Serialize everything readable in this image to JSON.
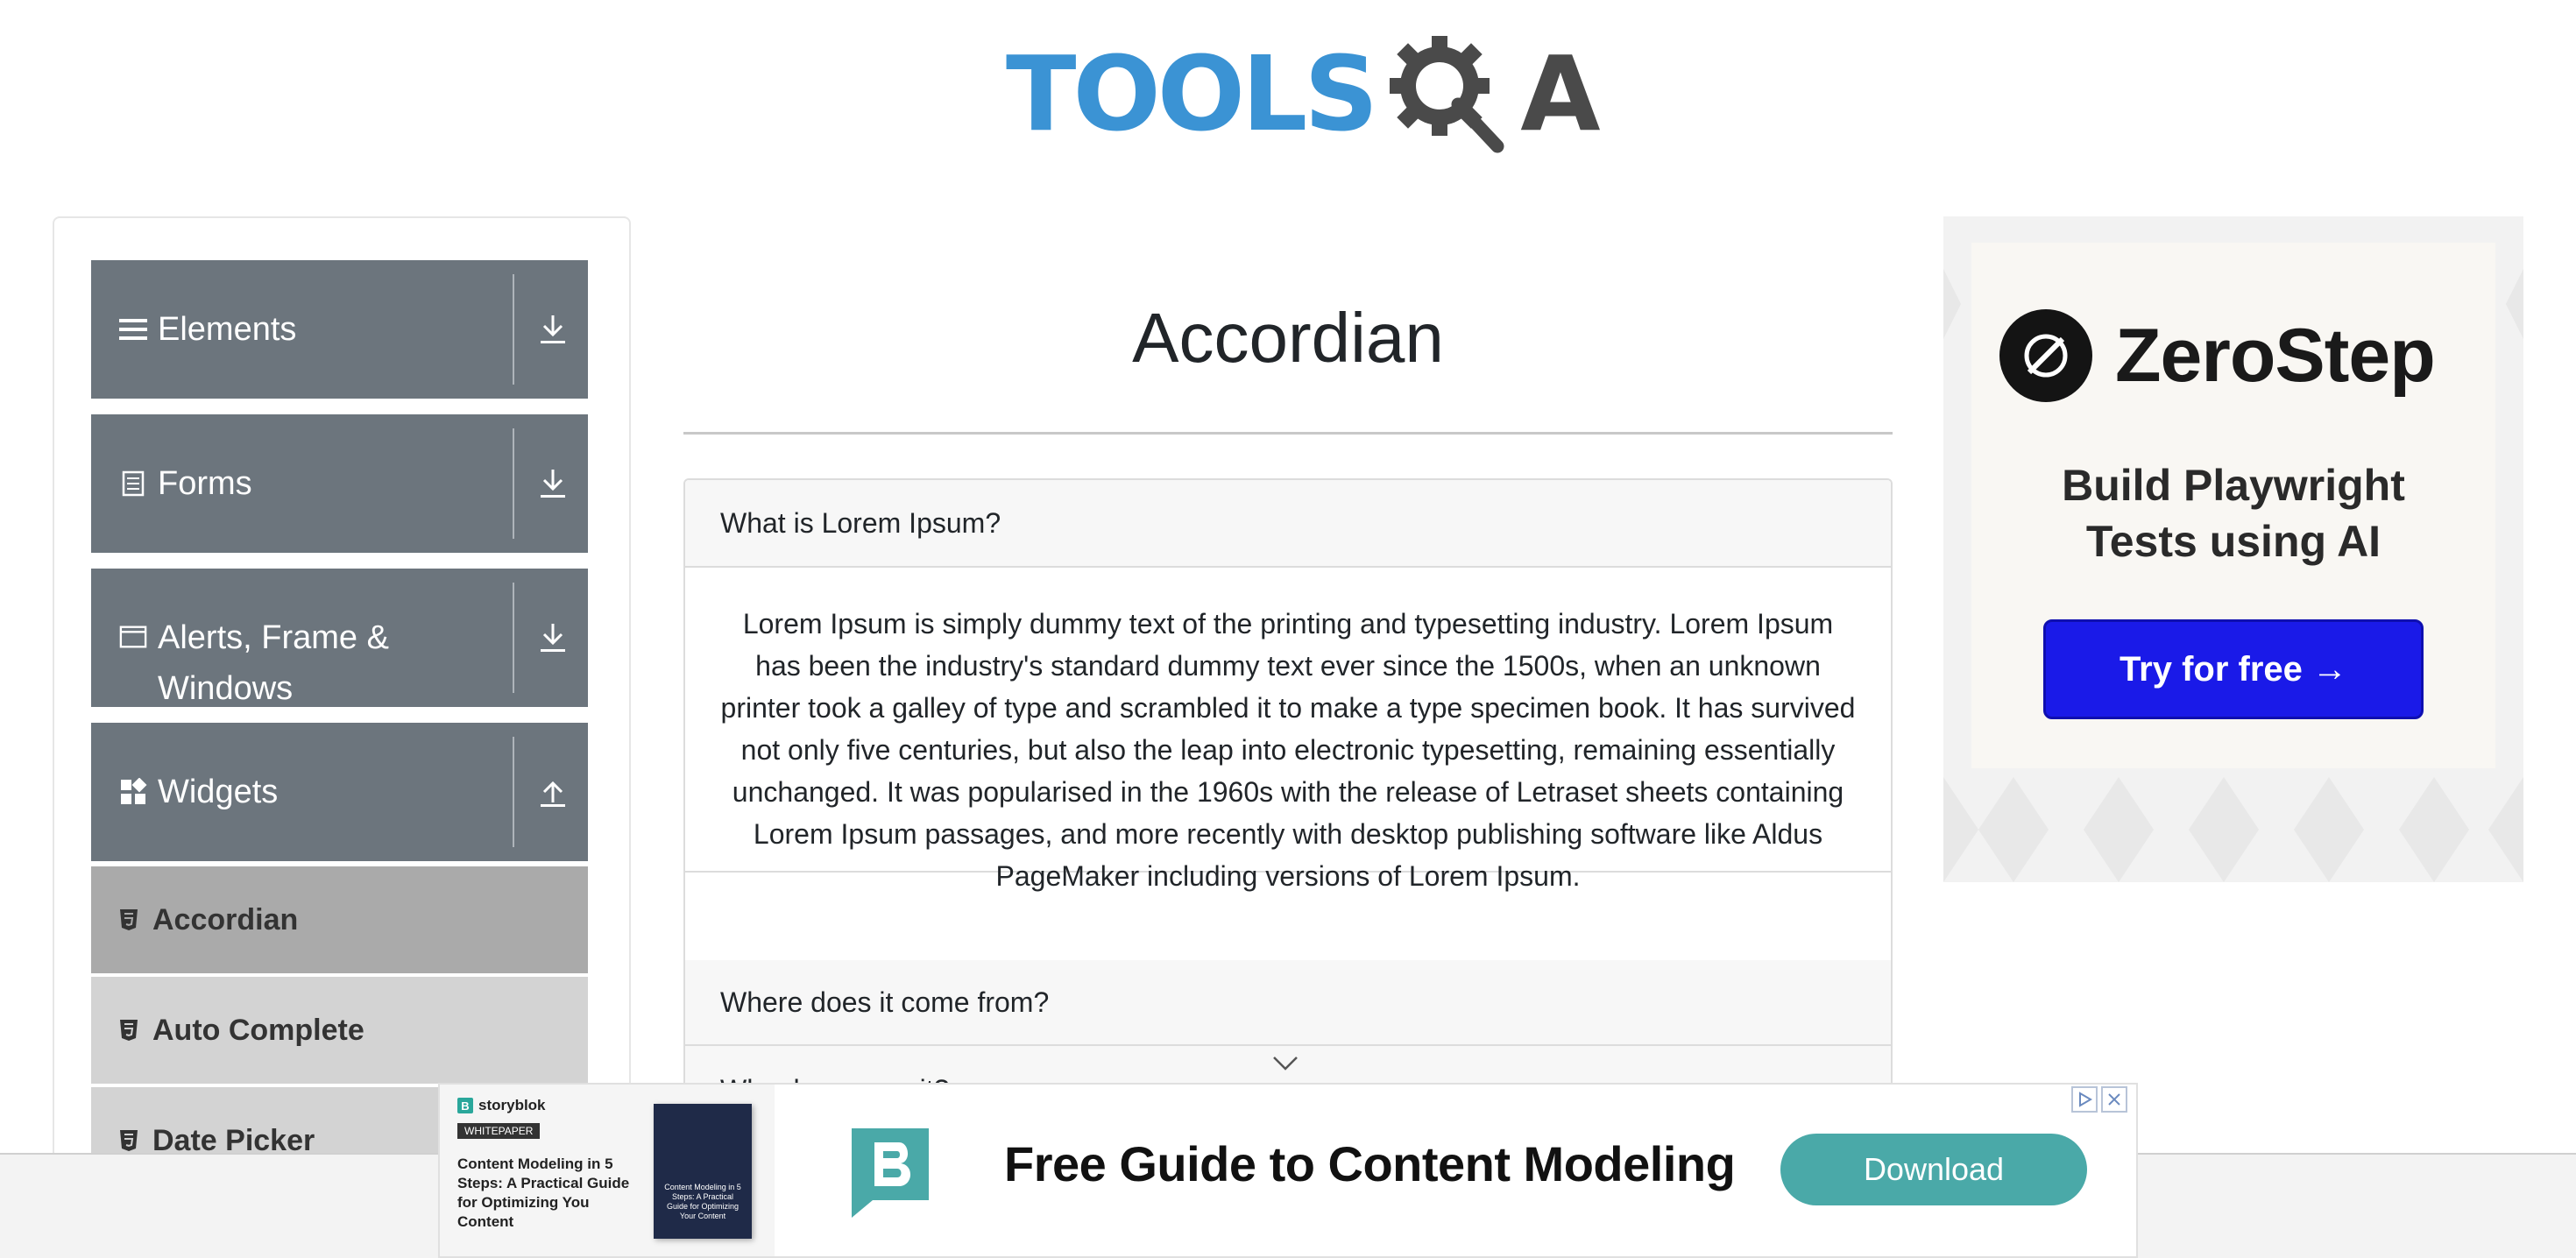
{
  "header": {
    "logo_text_tools": "TOOLS",
    "logo_text_a": "A"
  },
  "sidebar": {
    "groups": [
      {
        "label": "Elements",
        "icon": "hamburger-icon",
        "arrow": "download-arrow-icon"
      },
      {
        "label": "Forms",
        "icon": "document-icon",
        "arrow": "download-arrow-icon"
      },
      {
        "label": "Alerts, Frame &",
        "label_line2": "Windows",
        "icon": "window-icon",
        "arrow": "download-arrow-icon"
      },
      {
        "label": "Widgets",
        "icon": "widgets-icon",
        "arrow": "upload-arrow-icon"
      }
    ],
    "sub_items": [
      {
        "label": "Accordian",
        "active": true
      },
      {
        "label": "Auto Complete",
        "active": false
      },
      {
        "label": "Date Picker",
        "active": false
      }
    ]
  },
  "main": {
    "title": "Accordian",
    "sections": [
      {
        "heading": "What is Lorem Ipsum?",
        "expanded": true,
        "body": "Lorem Ipsum is simply dummy text of the printing and typesetting industry. Lorem Ipsum has been the industry's standard dummy text ever since the 1500s, when an unknown printer took a galley of type and scrambled it to make a type specimen book. It has survived not only five centuries, but also the leap into electronic typesetting, remaining essentially unchanged. It was popularised in the 1960s with the release of Letraset sheets containing Lorem Ipsum passages, and more recently with desktop publishing software like Aldus PageMaker including versions of Lorem Ipsum."
      },
      {
        "heading": "Where does it come from?",
        "expanded": false
      },
      {
        "heading": "Why do we use it?",
        "expanded": false
      }
    ]
  },
  "ad_right": {
    "brand": "ZeroStep",
    "tagline_line1": "Build Playwright",
    "tagline_line2": "Tests using AI",
    "cta": "Try for free →",
    "accent": "#1a1ae8"
  },
  "ad_bottom": {
    "sponsor": "storyblok",
    "badge": "WHITEPAPER",
    "promo_text": "Content Modeling in 5 Steps: A Practical Guide for Optimizing You Content",
    "book_text": "Content Modeling in 5 Steps: A Practical Guide for Optimizing Your Content",
    "headline": "Free Guide to Content Modeling",
    "cta": "Download",
    "accent": "#4aa9a8"
  },
  "colors": {
    "sidebar_group_bg": "#6c757d",
    "sub_item_bg": "#d3d3d3",
    "sub_item_active_bg": "#aaaaaa",
    "logo_blue": "#3b93d4"
  }
}
